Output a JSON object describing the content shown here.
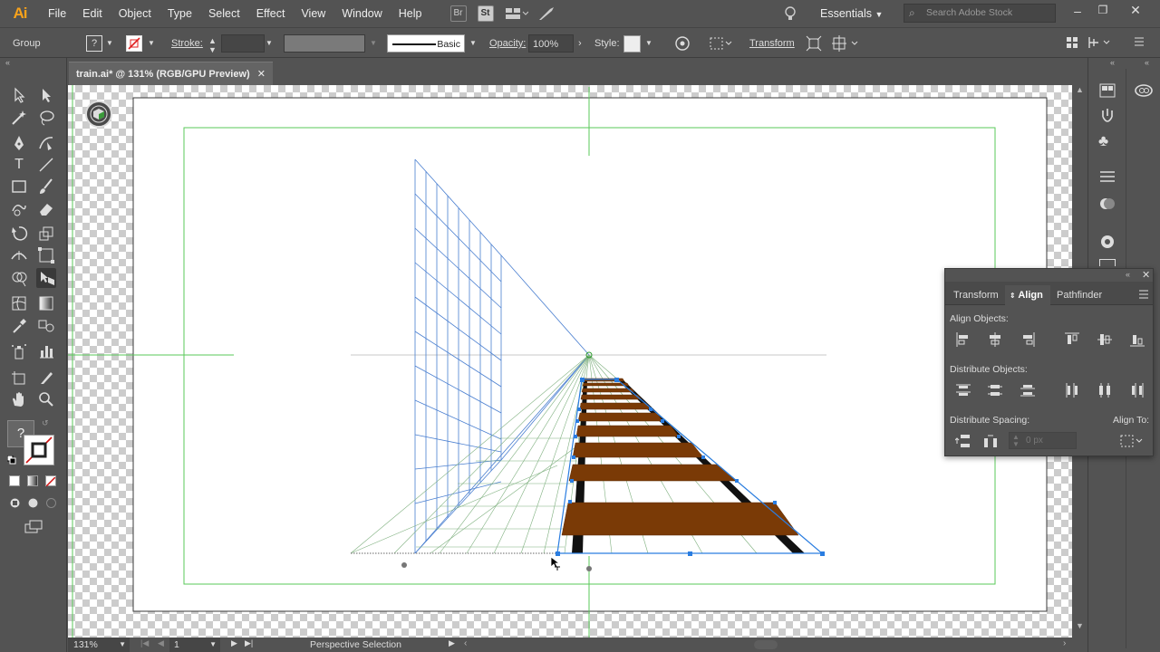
{
  "app": {
    "logo": "Ai"
  },
  "menu": [
    "File",
    "Edit",
    "Object",
    "Type",
    "Select",
    "Effect",
    "View",
    "Window",
    "Help"
  ],
  "menu_icons": {
    "bridge": "Br",
    "stock": "St"
  },
  "workspace": "Essentials",
  "search": {
    "placeholder": "Search Adobe Stock"
  },
  "control": {
    "selection": "Group",
    "fill_unknown": "?",
    "stroke_label": "Stroke:",
    "brush_label": "Basic",
    "opacity_label": "Opacity:",
    "opacity_value": "100%",
    "style_label": "Style:",
    "transform_label": "Transform"
  },
  "document": {
    "tab_title": "train.ai* @ 131% (RGB/GPU Preview)",
    "close": "✕"
  },
  "status": {
    "zoom": "131%",
    "artboard": "1",
    "tool": "Perspective Selection"
  },
  "panel": {
    "tabs": [
      "Transform",
      "Align",
      "Pathfinder"
    ],
    "active_tab": "Align",
    "align_objects_label": "Align Objects:",
    "distribute_objects_label": "Distribute Objects:",
    "distribute_spacing_label": "Distribute Spacing:",
    "align_to_label": "Align To:",
    "spacing_placeholder": "0 px"
  },
  "tools_box": {
    "unknown_fill": "?"
  },
  "colors": {
    "ui_bg": "#535353",
    "accent": "#f7a21b",
    "selection_blue": "#2a7de1",
    "tie_brown": "#7a3a06",
    "guide_green": "#5ac85a",
    "grid_blue": "#4a7fd0"
  }
}
